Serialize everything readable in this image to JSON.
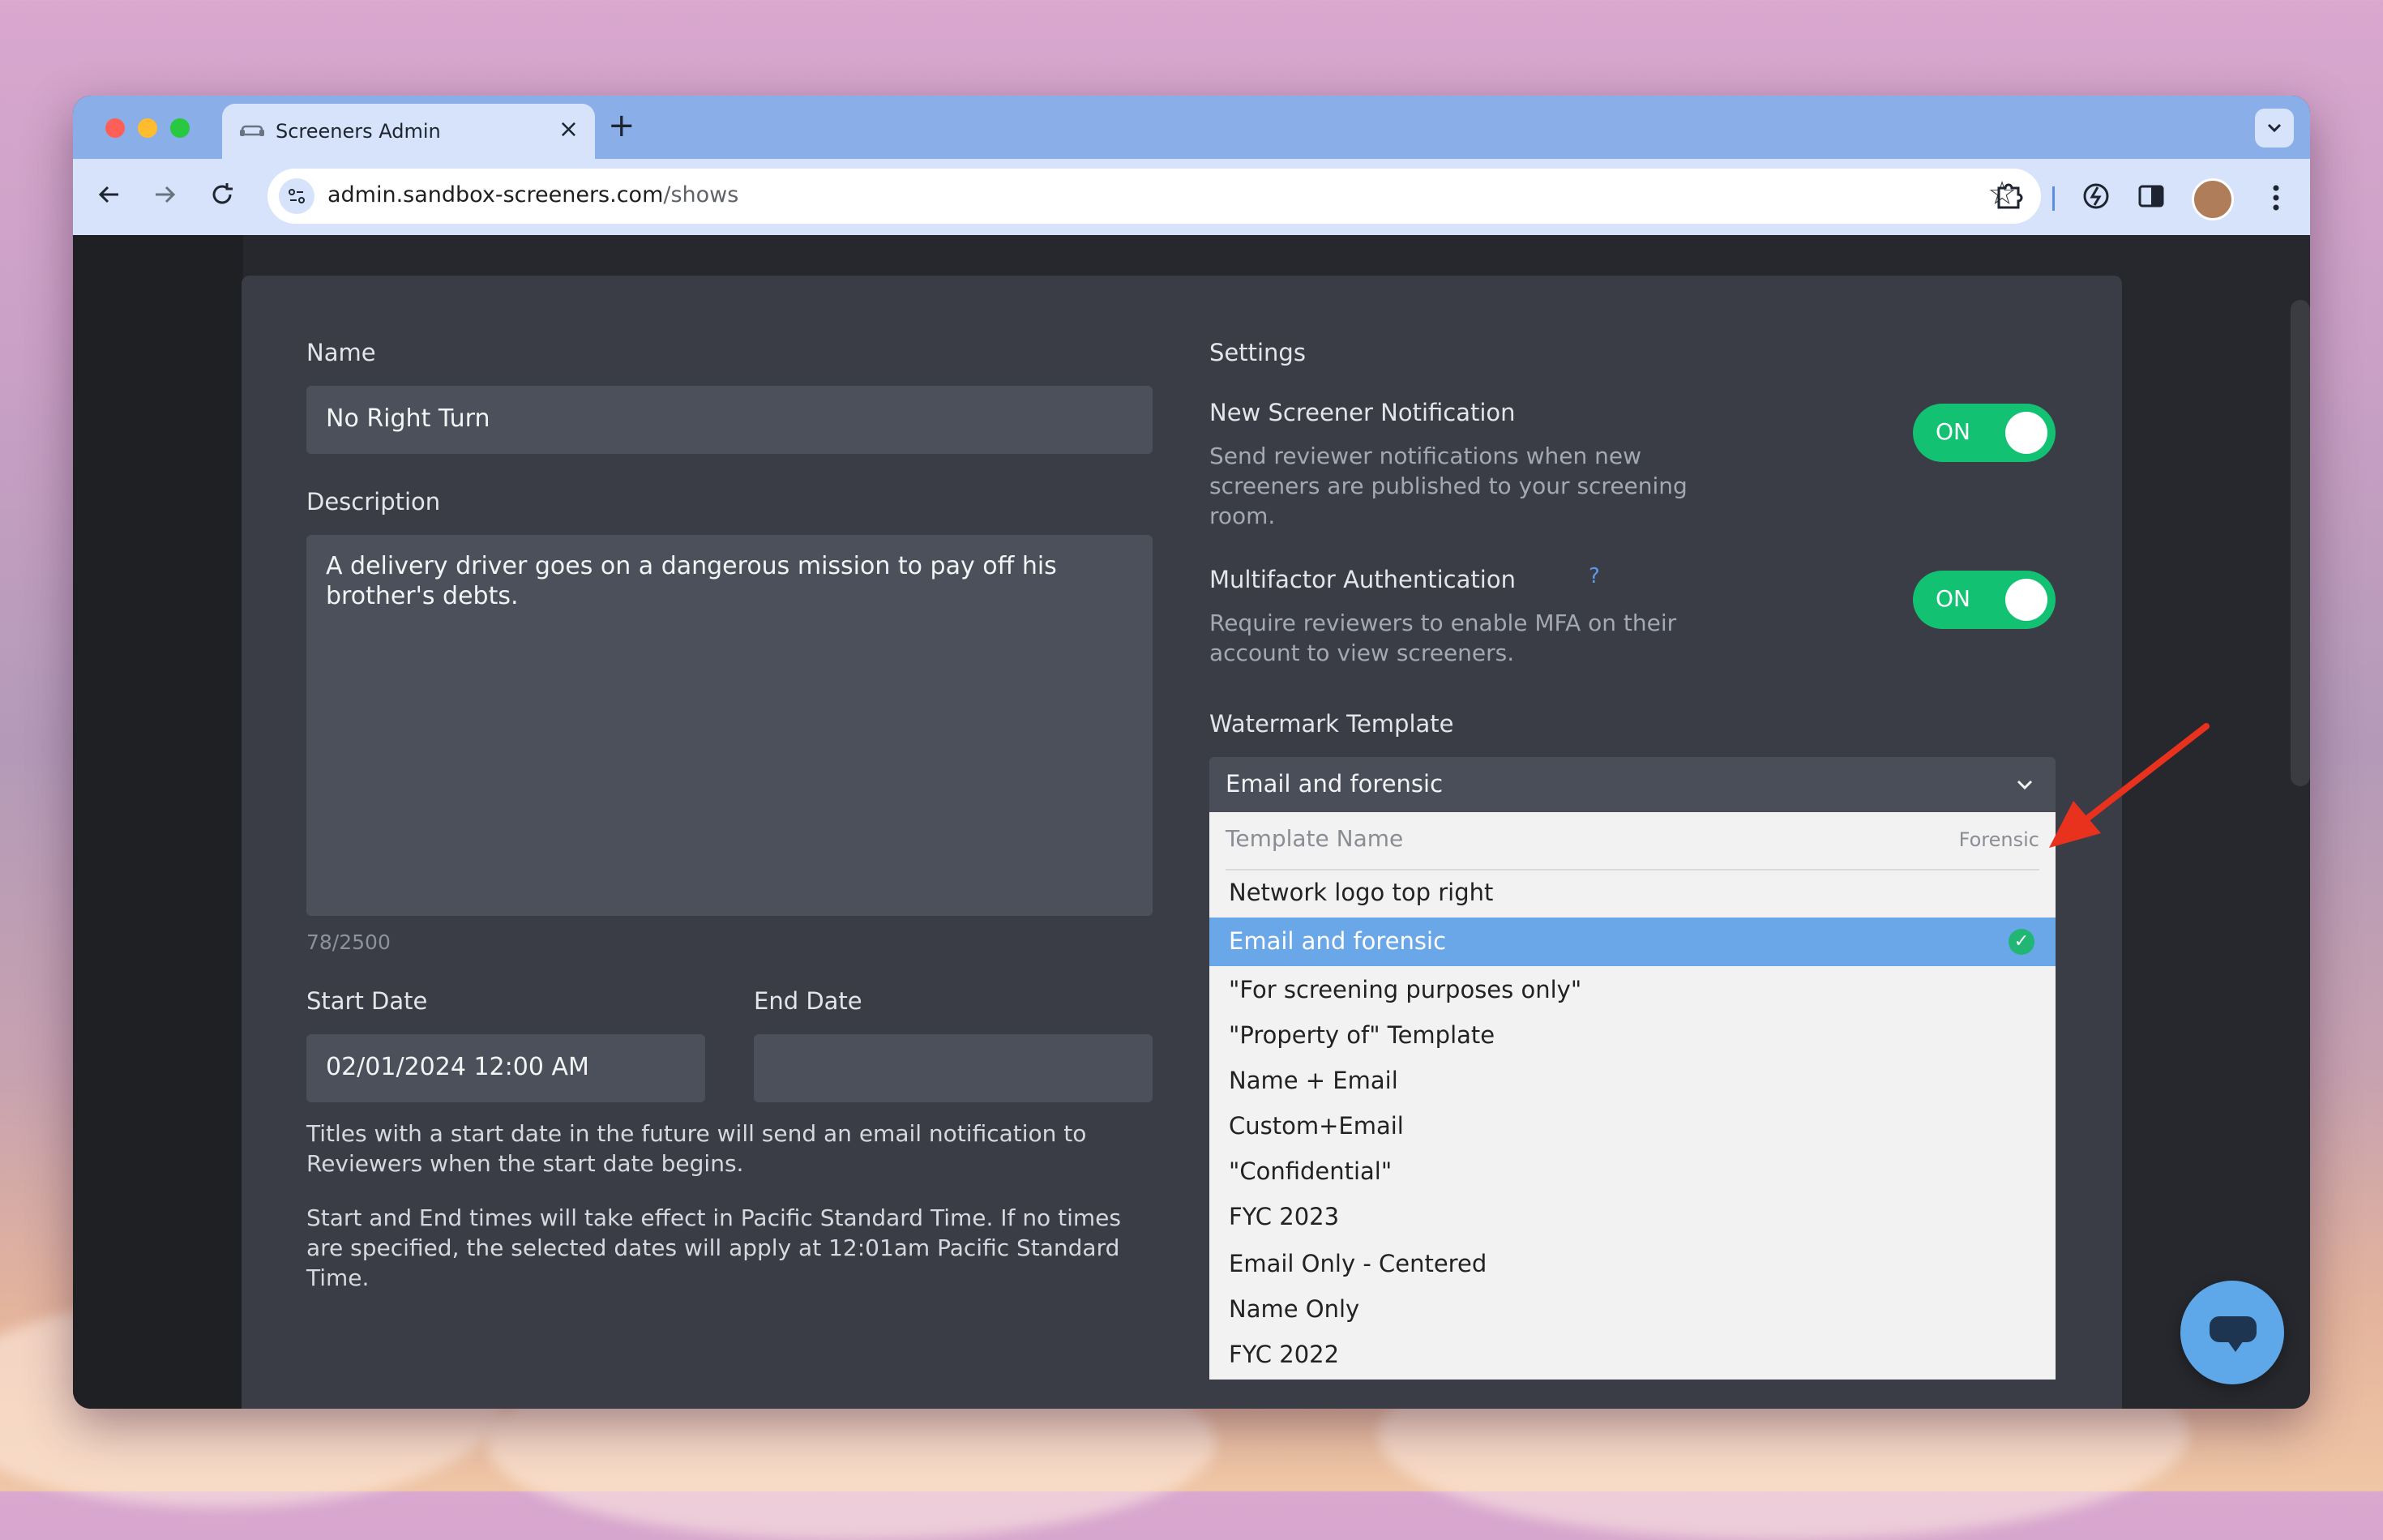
{
  "browser": {
    "tab_title": "Screeners Admin",
    "tab_close": "×",
    "new_tab": "+",
    "url_host": "admin.sandbox-screeners.com",
    "url_path": "/shows"
  },
  "form": {
    "name_label": "Name",
    "name_value": "No Right Turn",
    "description_label": "Description",
    "description_value": "A delivery driver goes on a dangerous mission to pay off his brother's debts.",
    "char_count": "78/2500",
    "start_date_label": "Start Date",
    "start_date_value": "02/01/2024 12:00 AM",
    "end_date_label": "End Date",
    "end_date_value": "",
    "date_help_1": "Titles with a start date in the future will send an email notification to Reviewers when the start date begins.",
    "date_help_2": "Start and End times will take effect in Pacific Standard Time. If no times are specified, the selected dates will apply at 12:01am Pacific Standard Time."
  },
  "settings": {
    "heading": "Settings",
    "notification_title": "New Screener Notification",
    "notification_desc": "Send reviewer notifications when new screeners are published to your screening room.",
    "notification_toggle": "ON",
    "mfa_title": "Multifactor Authentication",
    "mfa_help": "?",
    "mfa_desc": "Require reviewers to enable MFA on their account to view screeners.",
    "mfa_toggle": "ON",
    "watermark_label": "Watermark Template",
    "watermark_selected": "Email and forensic",
    "dropdown_header_name": "Template Name",
    "dropdown_header_forensic": "Forensic",
    "options": [
      "Network logo top right",
      "Email and forensic",
      "\"For screening purposes only\"",
      "\"Property of\" Template",
      "Name + Email",
      "Custom+Email",
      "\"Confidential\"",
      "FYC 2023",
      "Email Only - Centered",
      "Name Only",
      "FYC 2022"
    ]
  },
  "colors": {
    "toggle_on": "#12c272",
    "selected_option": "#6aa7e9",
    "annotation_arrow": "#e8321e"
  }
}
